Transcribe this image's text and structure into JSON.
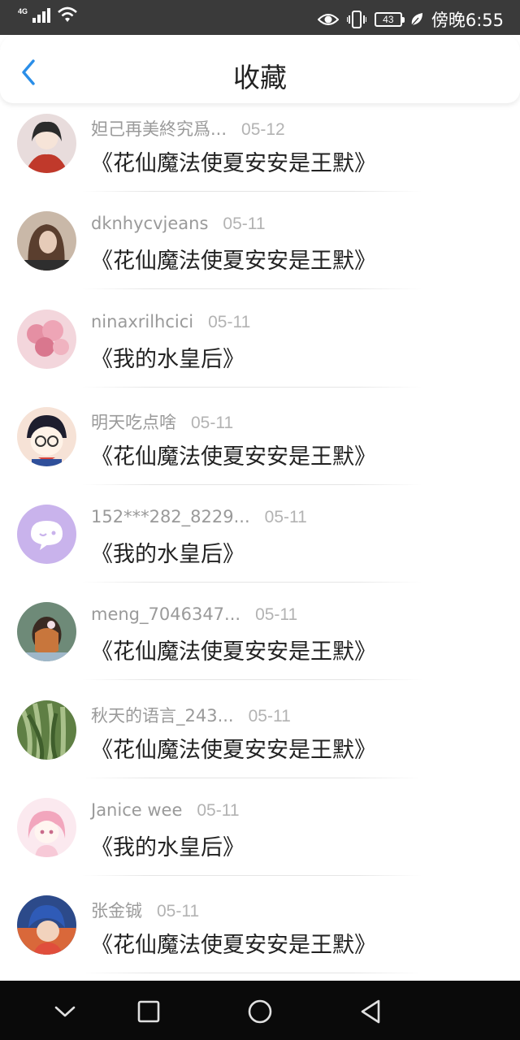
{
  "status_bar": {
    "network_type": "4G",
    "battery_level": "43",
    "time": "傍晚6:55"
  },
  "header": {
    "title": "收藏"
  },
  "favorites": [
    {
      "username": "妲己再美終究爲...",
      "date": "05-12",
      "title": "《花仙魔法使夏安安是王默》",
      "avatar": {
        "bg": "#e8dcdc",
        "accent": "#c0392b",
        "icon": "anime-girl-avatar"
      }
    },
    {
      "username": "dknhycvjeans",
      "date": "05-11",
      "title": "《花仙魔法使夏安安是王默》",
      "avatar": {
        "bg": "#c9b8a8",
        "accent": "#5a3e2e",
        "icon": "photo-avatar"
      }
    },
    {
      "username": "ninaxrilhcici",
      "date": "05-11",
      "title": "《我的水皇后》",
      "avatar": {
        "bg": "#f3d6dc",
        "accent": "#e58fa3",
        "icon": "balloons-avatar"
      }
    },
    {
      "username": "明天吃点啥",
      "date": "05-11",
      "title": "《花仙魔法使夏安安是王默》",
      "avatar": {
        "bg": "#f6e2d6",
        "accent": "#d9453b",
        "icon": "cartoon-boy-avatar"
      }
    },
    {
      "username": "152***282_8229...",
      "date": "05-11",
      "title": "《我的水皇后》",
      "avatar": {
        "bg": "#c9b3ec",
        "accent": "#ffffff",
        "icon": "chat-bubble-avatar"
      }
    },
    {
      "username": "meng_7046347...",
      "date": "05-11",
      "title": "《花仙魔法使夏安安是王默》",
      "avatar": {
        "bg": "#6e8a78",
        "accent": "#c8763c",
        "icon": "girl-back-avatar"
      }
    },
    {
      "username": "秋天的语言_243...",
      "date": "05-11",
      "title": "《花仙魔法使夏安安是王默》",
      "avatar": {
        "bg": "#5f7f44",
        "accent": "#a9c08a",
        "icon": "willow-tree-avatar"
      }
    },
    {
      "username": "Janice wee",
      "date": "05-11",
      "title": "《我的水皇后》",
      "avatar": {
        "bg": "#fbe9ef",
        "accent": "#f2a6bd",
        "icon": "pink-anime-avatar"
      }
    },
    {
      "username": "张金铖",
      "date": "05-11",
      "title": "《花仙魔法使夏安安是王默》",
      "avatar": {
        "bg": "#2c4a8a",
        "accent": "#d9683a",
        "icon": "anime-character-avatar"
      }
    }
  ],
  "nav_bar": {
    "icons": [
      "chevron-down-icon",
      "square-icon",
      "circle-icon",
      "triangle-back-icon"
    ]
  }
}
